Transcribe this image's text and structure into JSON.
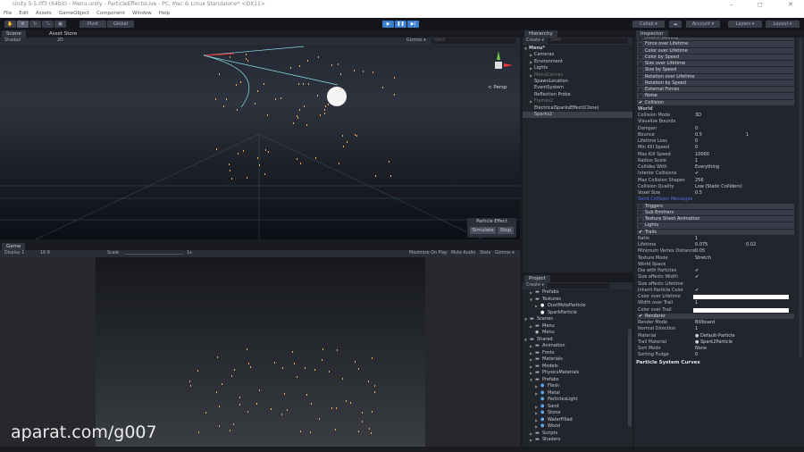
{
  "window": {
    "title": "Unity 5.5.0f3 (64bit) - Menu.unity - ParticleEffectsLive - PC, Mac & Linux Standalone* <DX11>",
    "minimize": "–",
    "maximize": "◻",
    "close": "✕"
  },
  "menu": [
    "File",
    "Edit",
    "Assets",
    "GameObject",
    "Component",
    "Window",
    "Help"
  ],
  "toolbar": {
    "pivot": "Pivot",
    "global": "Global",
    "collab": "Collab ▾",
    "account": "Account ▾",
    "layers": "Layers ▾",
    "layout": "Layout ▾"
  },
  "scene": {
    "tab": "Scene",
    "tab2": "Asset Store",
    "shading": "Shaded",
    "mode2d": "2D",
    "gizmos": "Gizmos ▾",
    "search": "Q▾All",
    "persp": "< Persp",
    "overlay_title": "Particle Effect",
    "simulate": "Simulate",
    "stop": "Stop"
  },
  "game": {
    "tab": "Game",
    "display": "Display 1",
    "aspect": "16:9",
    "scale_label": "Scale",
    "scale_value": "1x",
    "maximize": "Maximize On Play",
    "mute": "Mute Audio",
    "stats": "Stats",
    "gizmos": "Gizmos ▾"
  },
  "hierarchy": {
    "tab": "Hierarchy",
    "create": "Create ▾",
    "search": "Q▾All",
    "items": [
      {
        "label": "Menu*",
        "depth": 0,
        "arrow": true,
        "bold": true
      },
      {
        "label": "Cameras",
        "depth": 1,
        "arrow": true
      },
      {
        "label": "Environment",
        "depth": 1,
        "arrow": true
      },
      {
        "label": "Lights",
        "depth": 1,
        "arrow": true
      },
      {
        "label": "MenuCanvas",
        "depth": 1,
        "arrow": true,
        "dim": true
      },
      {
        "label": "SpawnLocation",
        "depth": 1
      },
      {
        "label": "EventSystem",
        "depth": 1
      },
      {
        "label": "Reflection Probe",
        "depth": 1
      },
      {
        "label": "Flames2",
        "depth": 1,
        "arrow": true,
        "dim": true
      },
      {
        "label": "ElectricalSparksEffect(Clone)",
        "depth": 1
      },
      {
        "label": "Sparks2",
        "depth": 1,
        "selected": true
      }
    ]
  },
  "project": {
    "tab": "Project",
    "create": "Create ▾",
    "items": [
      {
        "label": "Prefabs",
        "depth": 1,
        "icon": "folder"
      },
      {
        "label": "Textures",
        "depth": 1,
        "icon": "folder",
        "open": true
      },
      {
        "label": "DustMoteParticle",
        "depth": 2,
        "icon": "texture"
      },
      {
        "label": "SparkParticle",
        "depth": 2,
        "icon": "texture"
      },
      {
        "label": "Scenes",
        "depth": 0,
        "icon": "folder",
        "open": true
      },
      {
        "label": "Menu",
        "depth": 1,
        "icon": "folder"
      },
      {
        "label": "Menu",
        "depth": 1,
        "icon": "unity"
      },
      {
        "label": "Shared",
        "depth": 0,
        "icon": "folder",
        "open": true
      },
      {
        "label": "Animation",
        "depth": 1,
        "icon": "folder"
      },
      {
        "label": "Fonts",
        "depth": 1,
        "icon": "folder"
      },
      {
        "label": "Materials",
        "depth": 1,
        "icon": "folder"
      },
      {
        "label": "Models",
        "depth": 1,
        "icon": "folder"
      },
      {
        "label": "PhysicsMaterials",
        "depth": 1,
        "icon": "folder"
      },
      {
        "label": "Prefabs",
        "depth": 1,
        "icon": "folder",
        "open": true
      },
      {
        "label": "Flesh",
        "depth": 2,
        "icon": "prefab"
      },
      {
        "label": "Metal",
        "depth": 2,
        "icon": "prefab"
      },
      {
        "label": "ParticlesLight",
        "depth": 2,
        "icon": "prefab"
      },
      {
        "label": "Sand",
        "depth": 2,
        "icon": "prefab"
      },
      {
        "label": "Stone",
        "depth": 2,
        "icon": "prefab"
      },
      {
        "label": "WaterFilled",
        "depth": 2,
        "icon": "prefab"
      },
      {
        "label": "Wood",
        "depth": 2,
        "icon": "prefab"
      },
      {
        "label": "Scripts",
        "depth": 1,
        "icon": "folder"
      },
      {
        "label": "Shaders",
        "depth": 1,
        "icon": "folder"
      }
    ]
  },
  "inspector": {
    "tab": "Inspector",
    "footer": "Particle System Curves",
    "rows": [
      {
        "t": "mod",
        "label": "Inherit Velocity"
      },
      {
        "t": "mod",
        "label": "Force over Lifetime"
      },
      {
        "t": "mod",
        "label": "Color over Lifetime"
      },
      {
        "t": "mod",
        "label": "Color by Speed"
      },
      {
        "t": "mod",
        "label": "Size over Lifetime"
      },
      {
        "t": "mod",
        "label": "Size by Speed"
      },
      {
        "t": "mod",
        "label": "Rotation over Lifetime"
      },
      {
        "t": "mod",
        "label": "Rotation by Speed"
      },
      {
        "t": "mod",
        "label": "External Forces"
      },
      {
        "t": "mod",
        "label": "Noise"
      },
      {
        "t": "mod",
        "label": "Collision",
        "checked": true
      },
      {
        "t": "fl",
        "label": "World",
        "bold": true
      },
      {
        "t": "fl",
        "label": "Collision Mode",
        "value": "3D"
      },
      {
        "t": "fl",
        "label": "Visualize Bounds",
        "value": ""
      },
      {
        "t": "fl",
        "label": "Dampen",
        "value": "0"
      },
      {
        "t": "fl",
        "label": "Bounce",
        "value": "0.5",
        "value2": "1"
      },
      {
        "t": "fl",
        "label": "Lifetime Loss",
        "value": "0"
      },
      {
        "t": "fl",
        "label": "Min Kill Speed",
        "value": "0"
      },
      {
        "t": "fl",
        "label": "Max Kill Speed",
        "value": "10000"
      },
      {
        "t": "fl",
        "label": "Radius Scale",
        "value": "1"
      },
      {
        "t": "fl",
        "label": "Collides With",
        "value": "Everything"
      },
      {
        "t": "fl",
        "label": "Interior Collisions",
        "value": "✔"
      },
      {
        "t": "fl",
        "label": "Max Collision Shapes",
        "value": "256"
      },
      {
        "t": "fl",
        "label": "Collision Quality",
        "value": "Low (Static Colliders)"
      },
      {
        "t": "fl",
        "label": "Voxel Size",
        "value": "0.5"
      },
      {
        "t": "fl",
        "label": "Send Collision Messages",
        "link": true
      },
      {
        "t": "mod",
        "label": "Triggers"
      },
      {
        "t": "mod",
        "label": "Sub Emitters"
      },
      {
        "t": "mod",
        "label": "Texture Sheet Animation"
      },
      {
        "t": "mod",
        "label": "Lights"
      },
      {
        "t": "mod",
        "label": "Trails",
        "checked": true
      },
      {
        "t": "fl",
        "label": "Ratio",
        "value": "1"
      },
      {
        "t": "fl",
        "label": "Lifetime",
        "value": "0.075",
        "value2": "0.02"
      },
      {
        "t": "fl",
        "label": "Minimum Vertex Distance",
        "value": "0.05"
      },
      {
        "t": "fl",
        "label": "Texture Mode",
        "value": "Stretch"
      },
      {
        "t": "fl",
        "label": "World Space",
        "value": ""
      },
      {
        "t": "fl",
        "label": "Die with Particles",
        "value": "✔"
      },
      {
        "t": "fl",
        "label": "Size affects Width",
        "value": "✔"
      },
      {
        "t": "fl",
        "label": "Size affects Lifetime",
        "value": ""
      },
      {
        "t": "fl",
        "label": "Inherit Particle Color",
        "value": "✔"
      },
      {
        "t": "fl",
        "label": "Color over Lifetime",
        "swatch": true
      },
      {
        "t": "fl",
        "label": "Width over Trail",
        "value": "1"
      },
      {
        "t": "fl",
        "label": "Color over Trail",
        "swatch": true
      },
      {
        "t": "mod",
        "label": "Renderer",
        "checked": true
      },
      {
        "t": "fl",
        "label": "Render Mode",
        "value": "Billboard"
      },
      {
        "t": "fl",
        "label": "Normal Direction",
        "value": "1"
      },
      {
        "t": "fl",
        "label": "Material",
        "value": "● Default-Particle"
      },
      {
        "t": "fl",
        "label": "Trail Material",
        "value": "● Spark2Particle"
      },
      {
        "t": "fl",
        "label": "Sort Mode",
        "value": "None"
      },
      {
        "t": "fl",
        "label": "Sorting Fudge",
        "value": "0"
      }
    ]
  },
  "watermark": "aparat.com/g007",
  "colors": {
    "accent": "#3c7fd0",
    "panel": "#23252d",
    "module": "#3a3c4a"
  }
}
